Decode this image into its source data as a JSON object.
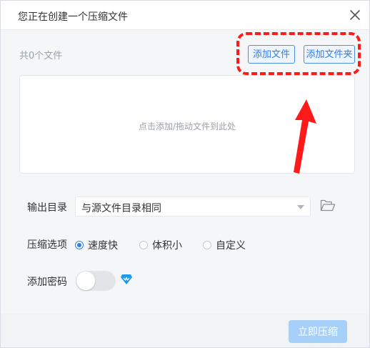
{
  "dialog": {
    "title": "您正在创建一个压缩文件",
    "file_count": "共0个文件",
    "add_file_label": "添加文件",
    "add_folder_label": "添加文件夹",
    "dropzone_hint": "点击添加/拖动文件到此处"
  },
  "form": {
    "output_label": "输出目录",
    "output_value": "与源文件目录相同",
    "compress_label": "压缩选项",
    "options": [
      {
        "label": "速度快",
        "checked": true
      },
      {
        "label": "体积小",
        "checked": false
      },
      {
        "label": "自定义",
        "checked": false
      }
    ],
    "password_label": "添加密码",
    "password_enabled": false
  },
  "footer": {
    "submit_label": "立即压缩"
  },
  "colors": {
    "accent": "#2f7fe6",
    "annotation": "#ff1a1a",
    "primary_disabled": "#a6d0f7"
  },
  "icons": [
    "close-icon",
    "folder-open-icon",
    "caret-down-icon",
    "vip-crown-icon"
  ]
}
